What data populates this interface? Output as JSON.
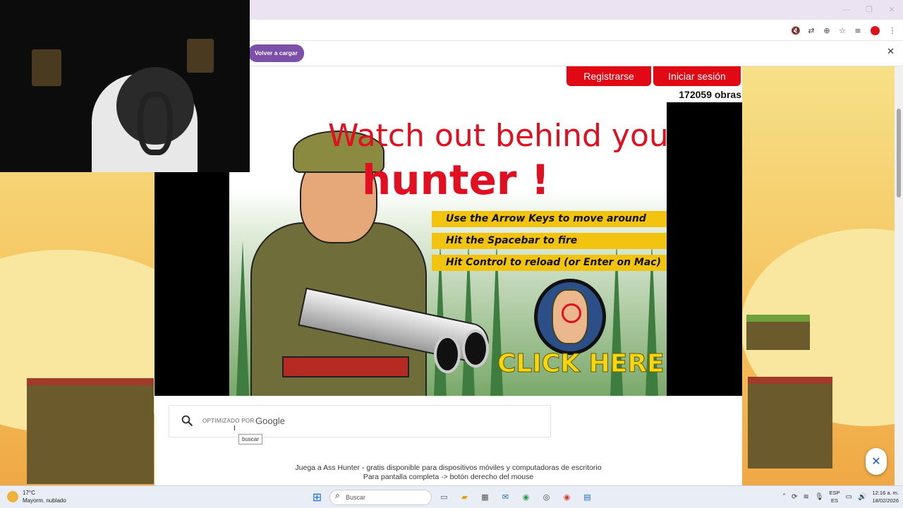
{
  "browser": {
    "reload_label": "Volver a cargar"
  },
  "site": {
    "register_label": "Registrarse",
    "login_label": "Iniciar sesión",
    "works_count": "172059 obras"
  },
  "game": {
    "title_line1": "Watch out behind you",
    "title_line2": "hunter !",
    "instructions": [
      "Use the Arrow Keys to move around",
      "Hit the Spacebar to fire",
      "Hit Control to reload (or Enter on Mac)"
    ],
    "click_here": "CLICK HERE"
  },
  "search": {
    "powered_by": "OPTIMIZADO POR",
    "brand": "Google",
    "tooltip": "buscar"
  },
  "footer": {
    "line1": "Juega a Ass Hunter - gratis disponible para dispositivos móviles y computadoras de escritorio",
    "line2": "Para pantalla completa -> botón derecho del mouse"
  },
  "taskbar": {
    "temperature": "17°C",
    "weather": "Mayorm. nublado",
    "search_placeholder": "Buscar",
    "lang_top": "ESP",
    "lang_bottom": "ES",
    "time": "12:16 a. m.",
    "date": "18/02/2026"
  },
  "colors": {
    "accent_red": "#e10a14",
    "reload_purple": "#7c4fa8",
    "instruction_yellow": "#f2c410"
  }
}
